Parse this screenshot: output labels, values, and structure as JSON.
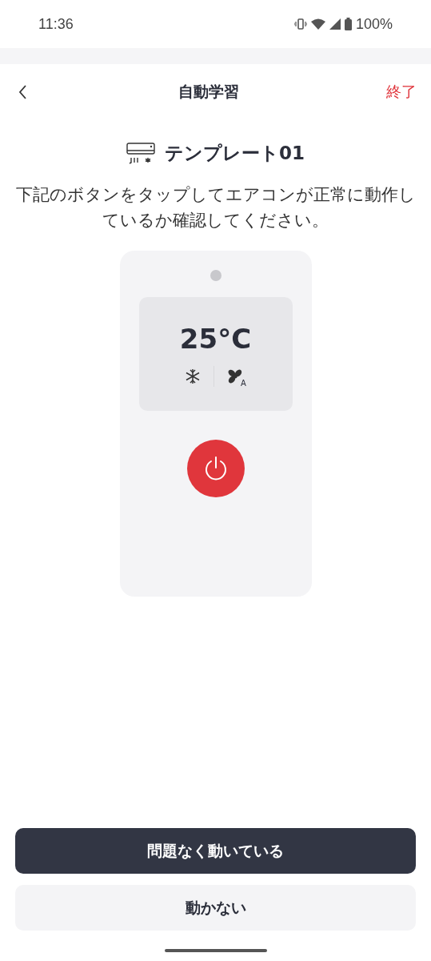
{
  "status_bar": {
    "time": "11:36",
    "battery": "100%"
  },
  "header": {
    "title": "自動学習",
    "action": "終了"
  },
  "device": {
    "name": "テンプレート01"
  },
  "instruction": "下記のボタンをタップしてエアコンが正常に動作しているか確認してください。",
  "remote": {
    "temperature": "25°C",
    "fan_mode": "A"
  },
  "buttons": [
    {
      "label": "問題なく動いている",
      "kind": "primary"
    },
    {
      "label": "動かない",
      "kind": "secondary"
    }
  ]
}
